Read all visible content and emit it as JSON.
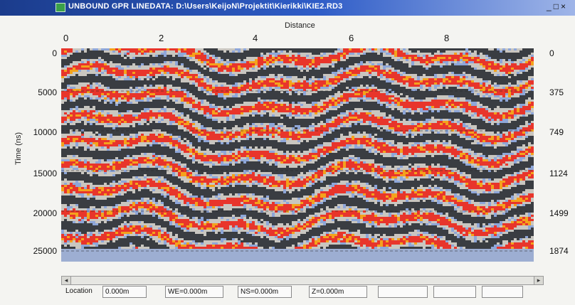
{
  "window": {
    "title": "UNBOUND GPR LINEDATA: D:\\Users\\KeijoN\\Projektit\\Kierikki\\KIE2.RD3",
    "controls": {
      "minimize": "_",
      "maximize": "□",
      "close": "×"
    }
  },
  "plot": {
    "x_axis_title": "Distance",
    "y_axis_title": "Time (ns)",
    "x_ticks": [
      "0",
      "2",
      "4",
      "6",
      "8"
    ],
    "y_ticks_left": [
      "0",
      "5000",
      "10000",
      "15000",
      "20000",
      "25000"
    ],
    "y_ticks_right": [
      "0",
      "375",
      "749",
      "1124",
      "1499",
      "1874"
    ],
    "colors": {
      "positive": "#e8352b",
      "strong": "#f4a21c",
      "negative": "#3a3d42",
      "neutral": "#c9c6c0",
      "low": "#8ea6d8"
    }
  },
  "scrollbar": {
    "left_arrow": "◂",
    "right_arrow": "▸"
  },
  "statusbar": {
    "location_label": "Location",
    "location_value": "0.000m",
    "we": "WE=0.000m",
    "ns": "NS=0.000m",
    "z": "Z=0.000m"
  }
}
